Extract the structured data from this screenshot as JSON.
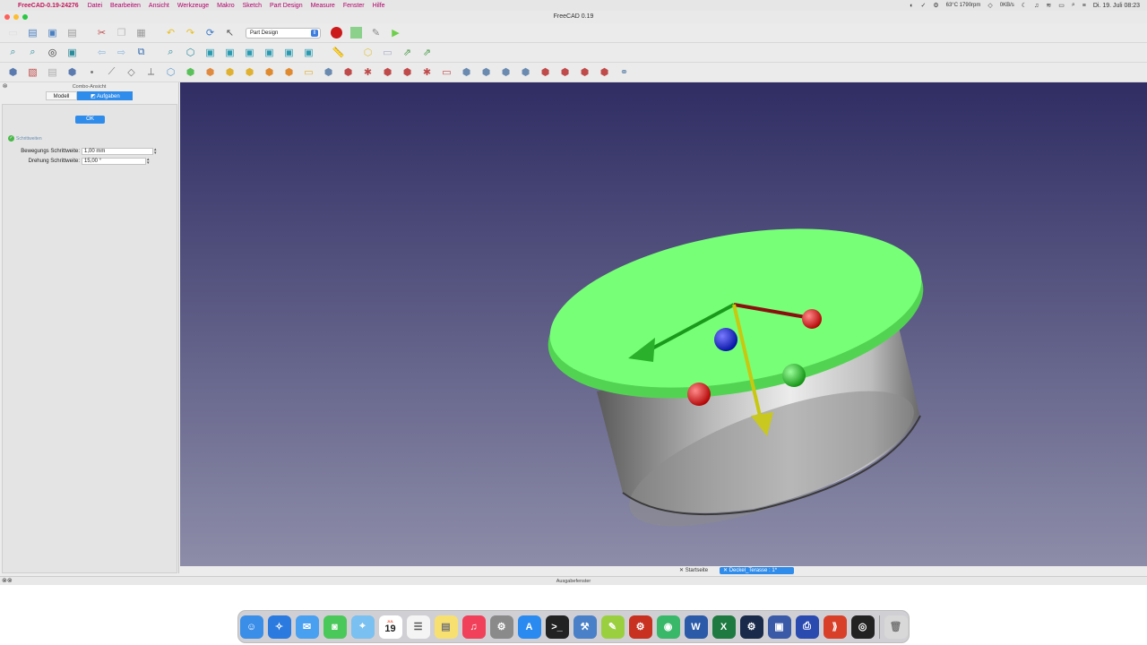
{
  "menubar": {
    "app_name": "FreeCAD-0.19-24276",
    "items": [
      "Datei",
      "Bearbeiten",
      "Ansicht",
      "Werkzeuge",
      "Makro",
      "Sketch",
      "Part Design",
      "Measure",
      "Fenster",
      "Hilfe"
    ],
    "status": {
      "temp": "63°C",
      "fan": "1790rpm",
      "net": "0KB/s",
      "datetime": "Di. 19. Juli 08:23"
    }
  },
  "window": {
    "title": "FreeCAD 0.19"
  },
  "toolbar": {
    "workbench": "Part Design"
  },
  "combo": {
    "title": "Combo-Ansicht",
    "tabs": [
      "Modell",
      "Aufgaben"
    ],
    "active_tab": "Aufgaben",
    "ok_label": "OK",
    "section_title": "Schrittweiten",
    "fields": [
      {
        "label": "Bewegungs Schrittweite:",
        "value": "1,00 mm"
      },
      {
        "label": "Drehung Schrittweite:",
        "value": "15,00 °"
      }
    ]
  },
  "view": {
    "colors": {
      "background_top": "#2f2d63",
      "background_bottom": "#8d8da9",
      "top_face": "#77ff77",
      "body": "#a9a9a9",
      "axis_x": "#dd1111",
      "axis_y": "#22cc22",
      "axis_z": "#d6d616"
    }
  },
  "document_tabs": [
    "Startseite",
    "Deckel_Terasse : 1*"
  ],
  "active_document": "Deckel_Terasse : 1*",
  "output": {
    "title": "Ausgabefenster"
  },
  "dock": {
    "calendar": {
      "month": "JUL",
      "day": "19"
    },
    "apps": [
      "finder",
      "safari",
      "mail",
      "messages",
      "maps",
      "calendar",
      "reminders",
      "notes",
      "music",
      "system-preferences",
      "app-store",
      "terminal",
      "xcode",
      "freecad-editor",
      "freecad",
      "prusa-slicer",
      "word",
      "excel",
      "steam",
      "vmware",
      "printer",
      "parallels",
      "obs",
      "trash"
    ]
  }
}
